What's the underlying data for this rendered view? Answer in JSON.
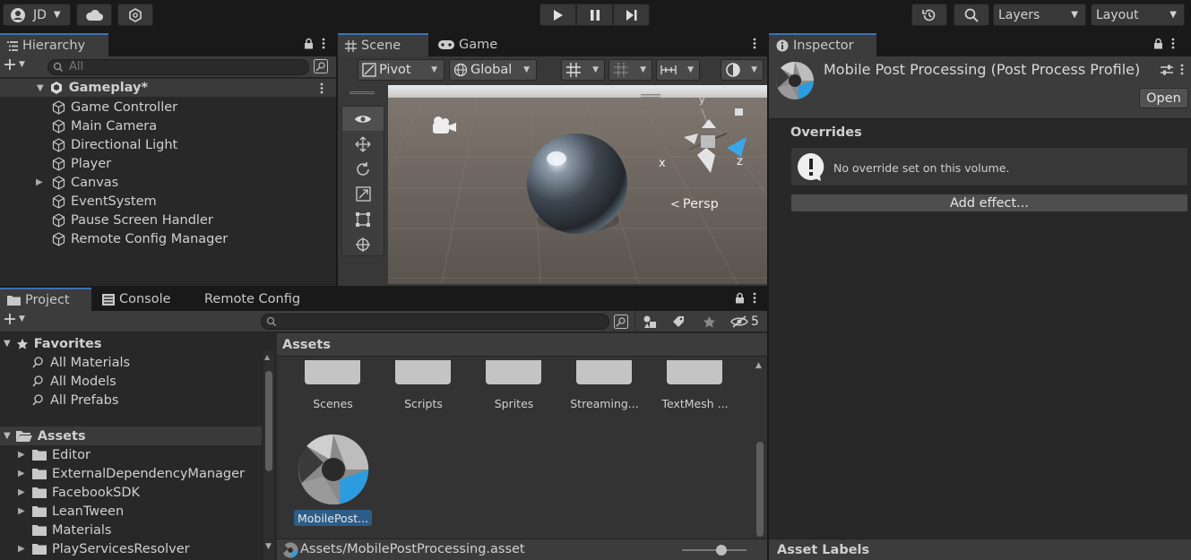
{
  "toolbar": {
    "account": "JD",
    "layers": "Layers",
    "layout": "Layout",
    "icons": [
      "account-icon",
      "cloud-icon",
      "collab-icon",
      "play-icon",
      "pause-icon",
      "step-icon",
      "history-icon",
      "search-icon"
    ]
  },
  "hierarchy": {
    "tab": "Hierarchy",
    "search_placeholder": "All",
    "scene": "Gameplay*",
    "items": [
      "Game Controller",
      "Main Camera",
      "Directional Light",
      "Player",
      "Canvas",
      "EventSystem",
      "Pause Screen Handler",
      "Remote Config Manager"
    ]
  },
  "scene": {
    "tabs": [
      "Scene",
      "Game"
    ],
    "pivot": "Pivot",
    "global": "Global",
    "persp": "Persp",
    "axis_x": "x",
    "axis_z": "z",
    "axis_y": "y"
  },
  "inspector": {
    "tab": "Inspector",
    "title": "Mobile Post Processing (Post Process Profile)",
    "open": "Open",
    "overrides": "Overrides",
    "no_override": "No override set on this volume.",
    "add_effect": "Add effect...",
    "asset_labels": "Asset Labels"
  },
  "project": {
    "tabs": [
      "Project",
      "Console",
      "Remote Config"
    ],
    "hidden_count": "5",
    "favorites": "Favorites",
    "favorite_items": [
      "All Materials",
      "All Models",
      "All Prefabs"
    ],
    "assets_root": "Assets",
    "asset_folders": [
      "Editor",
      "ExternalDependencyManager",
      "FacebookSDK",
      "LeanTween",
      "Materials",
      "PlayServicesResolver"
    ],
    "grid_header": "Assets",
    "grid_folders": [
      "Scenes",
      "Scripts",
      "Sprites",
      "Streaming...",
      "TextMesh ..."
    ],
    "selected_asset": "MobilePost...",
    "path": "Assets/MobilePostProcessing.asset"
  },
  "colors": {
    "accent": "#3a72b0",
    "panel": "#282828",
    "header": "#3c3c3c",
    "selection": "#2c5d87"
  }
}
